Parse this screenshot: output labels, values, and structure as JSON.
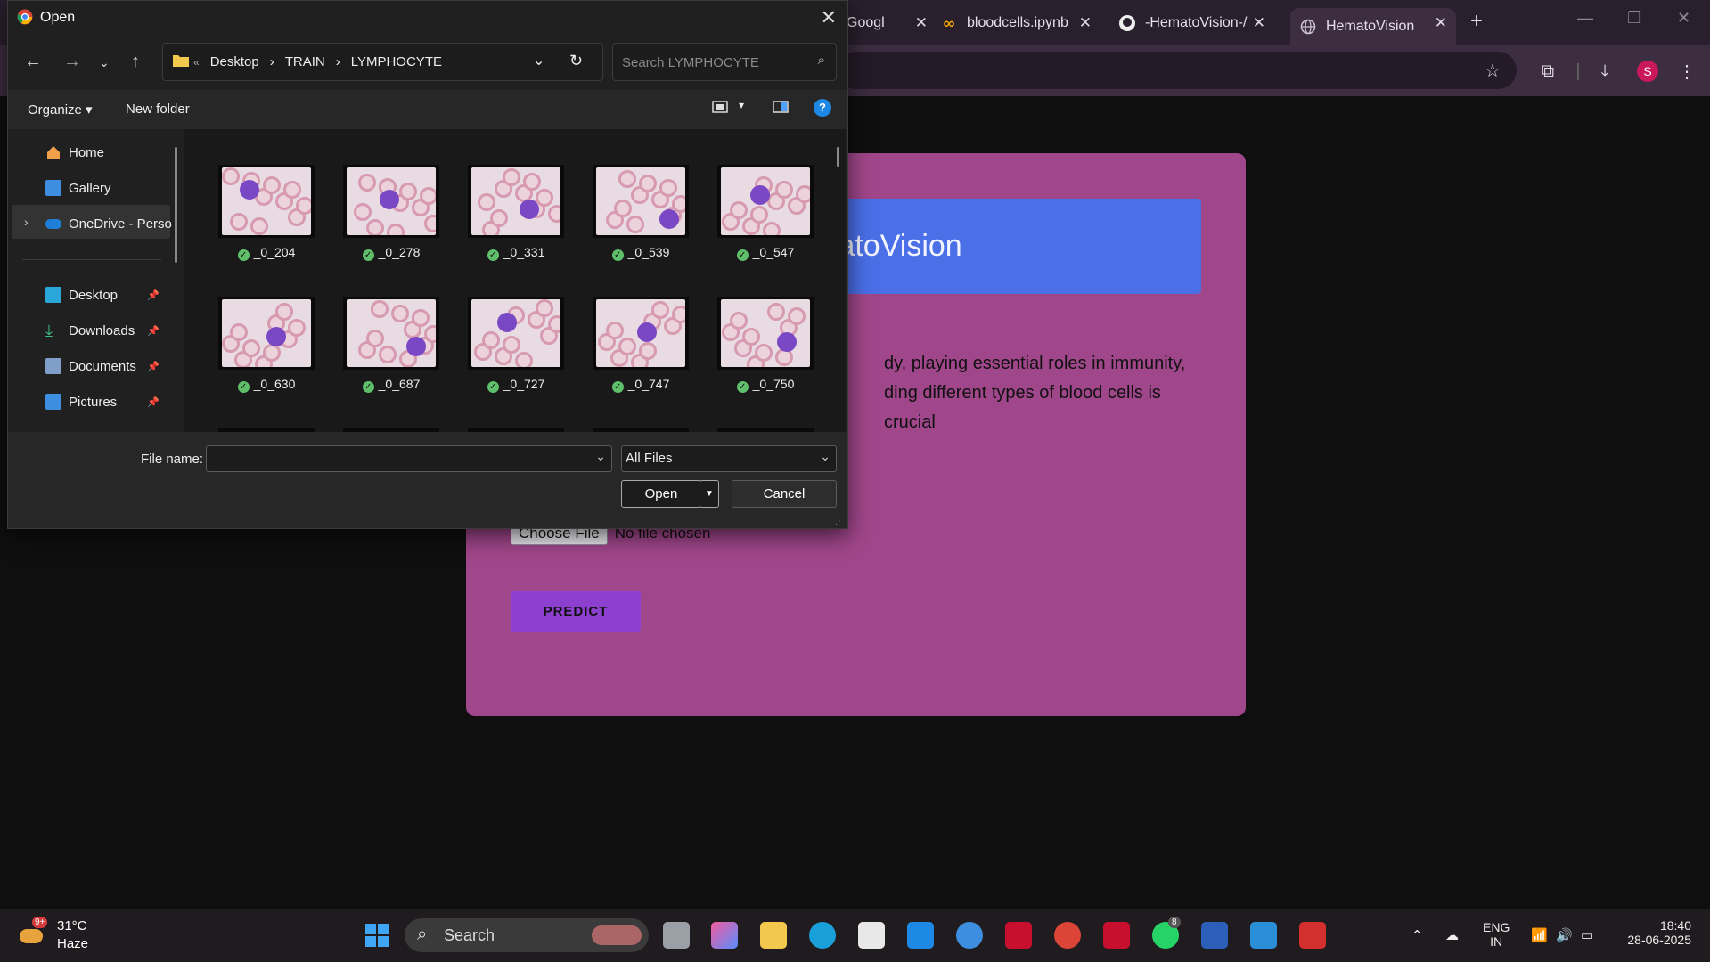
{
  "browser": {
    "tabs": [
      {
        "label": "Googl"
      },
      {
        "label": "bloodcells.ipynb"
      },
      {
        "label": "-HematoVision-/"
      },
      {
        "label": "HematoVision"
      }
    ],
    "profile_initial": "S"
  },
  "page": {
    "banner_title": "e HematoVision",
    "desc_line1": "dy, playing essential roles in immunity,",
    "desc_line2": "ding different types of blood cells is crucial",
    "choose_file": "Choose File",
    "no_file": "No file chosen",
    "predict": "PREDICT",
    "card_color": "#a0468a",
    "banner_color": "#4a6fe7"
  },
  "dialog": {
    "title": "Open",
    "breadcrumbs": [
      "«",
      "Desktop",
      "›",
      "TRAIN",
      "›",
      "LYMPHOCYTE"
    ],
    "search_placeholder": "Search LYMPHOCYTE",
    "organize": "Organize ▾",
    "new_folder": "New folder",
    "nav": {
      "home": "Home",
      "gallery": "Gallery",
      "onedrive": "OneDrive - Perso",
      "desktop": "Desktop",
      "downloads": "Downloads",
      "documents": "Documents",
      "pictures": "Pictures"
    },
    "files": [
      "_0_204",
      "_0_278",
      "_0_331",
      "_0_539",
      "_0_547",
      "_0_630",
      "_0_687",
      "_0_727",
      "_0_747",
      "_0_750"
    ],
    "file_name_label": "File name:",
    "file_name_value": "",
    "file_type": "All Files",
    "open_button": "Open",
    "cancel_button": "Cancel"
  },
  "taskbar": {
    "weather_temp": "31°C",
    "weather_desc": "Haze",
    "weather_badge": "9+",
    "search": "Search",
    "lang": "ENG",
    "region": "IN",
    "time": "18:40",
    "date": "28-06-2025",
    "whatsapp_badge": "8"
  }
}
